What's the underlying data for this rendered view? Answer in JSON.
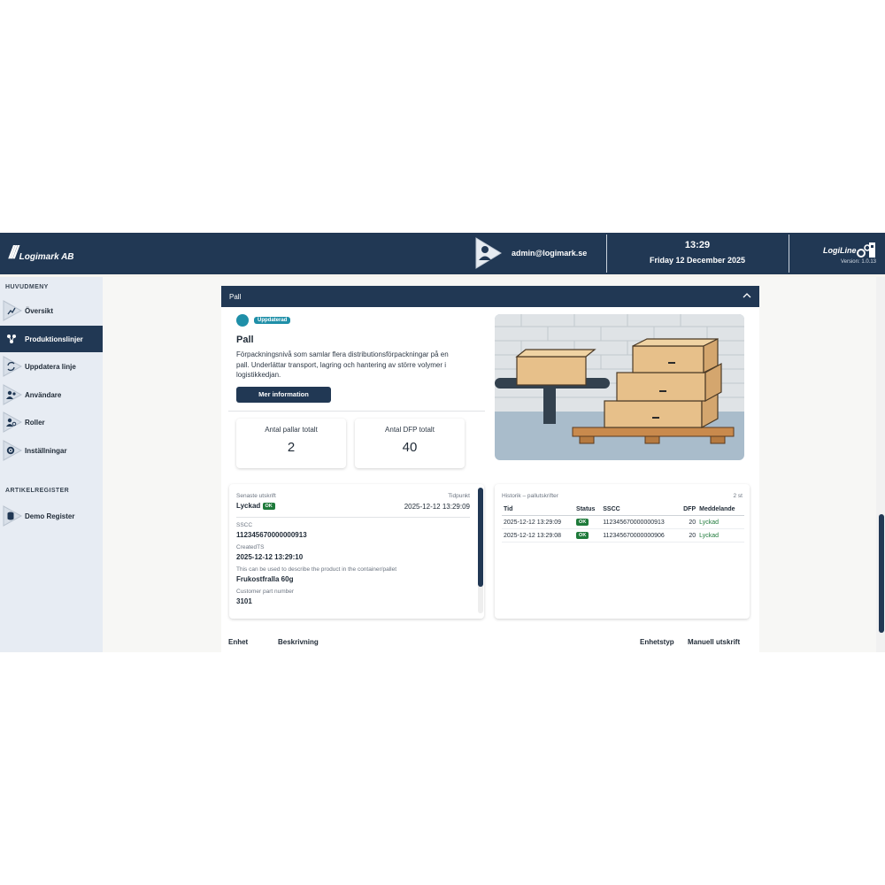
{
  "header": {
    "company": "Logimark AB",
    "user_email": "admin@logimark.se",
    "time": "13:29",
    "date": "Friday 12 December 2025",
    "brand": "LogiLine",
    "version": "Version: 1.0.13",
    "colors": {
      "header_bg": "#213854",
      "accent": "#1f8fa8",
      "ok": "#1e7a3a"
    }
  },
  "sidebar": {
    "main_heading": "HUVUDMENY",
    "items": [
      {
        "label": "Översikt",
        "icon": "chart-line-icon"
      },
      {
        "label": "Produktionslinjer",
        "icon": "network-icon",
        "active": true
      },
      {
        "label": "Uppdatera linje",
        "icon": "refresh-icon"
      },
      {
        "label": "Användare",
        "icon": "users-icon"
      },
      {
        "label": "Roller",
        "icon": "user-gear-icon"
      },
      {
        "label": "Inställningar",
        "icon": "gear-icon"
      }
    ],
    "register_heading": "ARTIKELREGISTER",
    "register_items": [
      {
        "label": "Demo Register",
        "icon": "database-icon"
      }
    ]
  },
  "pall": {
    "panel_title": "Pall",
    "badge": "Uppdaterad",
    "title": "Pall",
    "description": "Förpackningsnivå som samlar flera distributionsförpackningar på en pall. Underlättar transport, lagring och hantering av större volymer i logistikkedjan.",
    "more_button": "Mer information",
    "stats": [
      {
        "label": "Antal pallar totalt",
        "value": "2"
      },
      {
        "label": "Antal DFP totalt",
        "value": "40"
      }
    ]
  },
  "latest": {
    "label_left": "Senaste utskrift",
    "label_right": "Tidpunkt",
    "status": "Lyckad",
    "status_badge": "OK",
    "timestamp": "2025-12-12 13:29:09",
    "fields": [
      {
        "key": "SSCC",
        "value": "112345670000000913"
      },
      {
        "key": "CreatedTS",
        "value": "2025-12-12 13:29:10"
      },
      {
        "key": "This can be used to describe the product in the container/pallet",
        "value": "Frukostfralla 60g"
      },
      {
        "key": "Customer part number",
        "value": "3101"
      }
    ]
  },
  "history": {
    "title": "Historik – pallutskrifter",
    "count": "2 st",
    "columns": [
      "Tid",
      "Status",
      "SSCC",
      "DFP",
      "Meddelande"
    ],
    "rows": [
      {
        "tid": "2025-12-12 13:29:09",
        "status": "OK",
        "sscc": "112345670000000913",
        "dfp": "20",
        "msg": "Lyckad"
      },
      {
        "tid": "2025-12-12 13:29:08",
        "status": "OK",
        "sscc": "112345670000000906",
        "dfp": "20",
        "msg": "Lyckad"
      }
    ]
  },
  "units_table": {
    "columns": [
      "Enhet",
      "Beskrivning",
      "Enhetstyp",
      "Manuell utskrift"
    ]
  }
}
